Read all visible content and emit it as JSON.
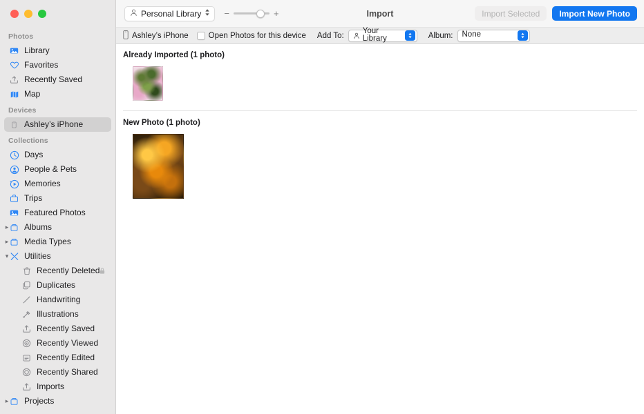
{
  "window": {
    "traffic_lights": [
      "close",
      "minimize",
      "zoom"
    ]
  },
  "toolbar": {
    "library_popup_label": "Personal Library",
    "zoom_out_label": "−",
    "zoom_in_label": "+",
    "title": "Import",
    "import_selected_label": "Import Selected",
    "import_new_photo_label": "Import New Photo",
    "accent_color": "#1277f0"
  },
  "import_bar": {
    "device_name": "Ashley’s iPhone",
    "open_photos_label": "Open Photos for this device",
    "open_photos_checked": false,
    "add_to_label": "Add To:",
    "add_to_value": "Your Library",
    "album_label": "Album:",
    "album_value": "None"
  },
  "sidebar": {
    "sections": [
      {
        "header": "Photos",
        "items": [
          {
            "label": "Library",
            "icon": "library-icon",
            "selected": false
          },
          {
            "label": "Favorites",
            "icon": "heart-icon",
            "selected": false
          },
          {
            "label": "Recently Saved",
            "icon": "tray-arrow-up-icon",
            "selected": false
          },
          {
            "label": "Map",
            "icon": "map-icon",
            "selected": false
          }
        ]
      },
      {
        "header": "Devices",
        "items": [
          {
            "label": "Ashley’s iPhone",
            "icon": "iphone-icon",
            "selected": true
          }
        ]
      },
      {
        "header": "Collections",
        "items": [
          {
            "label": "Days",
            "icon": "clock-icon",
            "selected": false
          },
          {
            "label": "People & Pets",
            "icon": "person-circle-icon",
            "selected": false
          },
          {
            "label": "Memories",
            "icon": "memories-play-icon",
            "selected": false
          },
          {
            "label": "Trips",
            "icon": "suitcase-icon",
            "selected": false
          },
          {
            "label": "Featured Photos",
            "icon": "featured-photo-icon",
            "selected": false
          },
          {
            "label": "Albums",
            "icon": "albums-folder-icon",
            "disclosure": "collapsed",
            "selected": false
          },
          {
            "label": "Media Types",
            "icon": "media-types-folder-icon",
            "disclosure": "collapsed",
            "selected": false
          },
          {
            "label": "Utilities",
            "icon": "utilities-tools-icon",
            "disclosure": "expanded",
            "selected": false
          },
          {
            "label": "Recently Deleted",
            "icon": "trash-icon",
            "nested": true,
            "badge": "lock-icon",
            "selected": false
          },
          {
            "label": "Duplicates",
            "icon": "duplicates-icon",
            "nested": true,
            "selected": false
          },
          {
            "label": "Handwriting",
            "icon": "handwriting-pen-icon",
            "nested": true,
            "selected": false
          },
          {
            "label": "Illustrations",
            "icon": "illustrations-icon",
            "nested": true,
            "selected": false
          },
          {
            "label": "Recently Saved",
            "icon": "tray-arrow-up-icon",
            "nested": true,
            "selected": false
          },
          {
            "label": "Recently Viewed",
            "icon": "recently-viewed-icon",
            "nested": true,
            "selected": false
          },
          {
            "label": "Recently Edited",
            "icon": "recently-edited-icon",
            "nested": true,
            "selected": false
          },
          {
            "label": "Recently Shared",
            "icon": "recently-shared-icon",
            "nested": true,
            "selected": false
          },
          {
            "label": "Imports",
            "icon": "tray-arrow-up-icon",
            "nested": true,
            "selected": false
          },
          {
            "label": "Projects",
            "icon": "projects-folder-icon",
            "disclosure": "collapsed",
            "selected": false
          }
        ]
      }
    ]
  },
  "content": {
    "groups": [
      {
        "title": "Already Imported (1 photo)",
        "photos": [
          {
            "name": "pink-flowers-photo",
            "size": "small",
            "colors": [
              "#4a6b2c",
              "#7fa04a",
              "#e8a8c8",
              "#f2e4ea",
              "#5d7a33",
              "#2f4a1c"
            ]
          }
        ]
      },
      {
        "title": "New Photo (1 photo)",
        "photos": [
          {
            "name": "orange-flowers-photo",
            "size": "large",
            "colors": [
              "#f5a623",
              "#e8890b",
              "#7a4a18",
              "#2a1c08",
              "#ffc845",
              "#c4700d"
            ]
          }
        ]
      }
    ]
  }
}
